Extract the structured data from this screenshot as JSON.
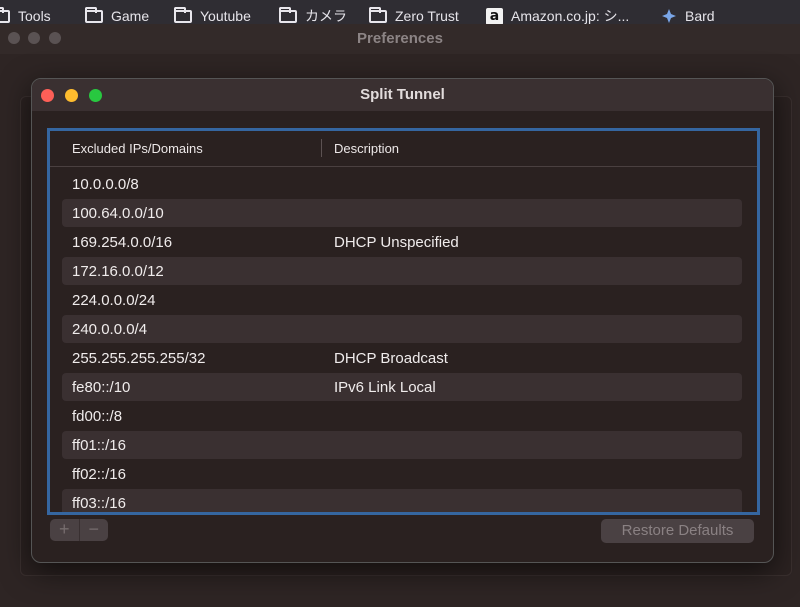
{
  "bookmarks": [
    {
      "label": "Tools",
      "icon": "folder-icon"
    },
    {
      "label": "Game",
      "icon": "folder-icon"
    },
    {
      "label": "Youtube",
      "icon": "folder-icon"
    },
    {
      "label": "カメラ",
      "icon": "folder-icon"
    },
    {
      "label": "Zero Trust",
      "icon": "folder-icon"
    },
    {
      "label": "Amazon.co.jp: シ...",
      "icon": "amazon-icon"
    },
    {
      "label": "Bard",
      "icon": "bard-icon"
    }
  ],
  "preferences": {
    "title": "Preferences"
  },
  "split_tunnel": {
    "title": "Split Tunnel",
    "columns": {
      "ip": "Excluded IPs/Domains",
      "description": "Description"
    },
    "rows": [
      {
        "ip": "10.0.0.0/8",
        "description": ""
      },
      {
        "ip": "100.64.0.0/10",
        "description": ""
      },
      {
        "ip": "169.254.0.0/16",
        "description": "DHCP Unspecified"
      },
      {
        "ip": "172.16.0.0/12",
        "description": ""
      },
      {
        "ip": "224.0.0.0/24",
        "description": ""
      },
      {
        "ip": "240.0.0.0/4",
        "description": ""
      },
      {
        "ip": "255.255.255.255/32",
        "description": "DHCP Broadcast"
      },
      {
        "ip": "fe80::/10",
        "description": "IPv6 Link Local"
      },
      {
        "ip": "fd00::/8",
        "description": ""
      },
      {
        "ip": "ff01::/16",
        "description": ""
      },
      {
        "ip": "ff02::/16",
        "description": ""
      },
      {
        "ip": "ff03::/16",
        "description": ""
      }
    ],
    "add_label": "+",
    "remove_label": "−",
    "restore_label": "Restore Defaults"
  },
  "colors": {
    "selection_border": "#3566a0",
    "close": "#fe5f57",
    "minimize": "#febc2e",
    "zoom": "#28c840"
  }
}
